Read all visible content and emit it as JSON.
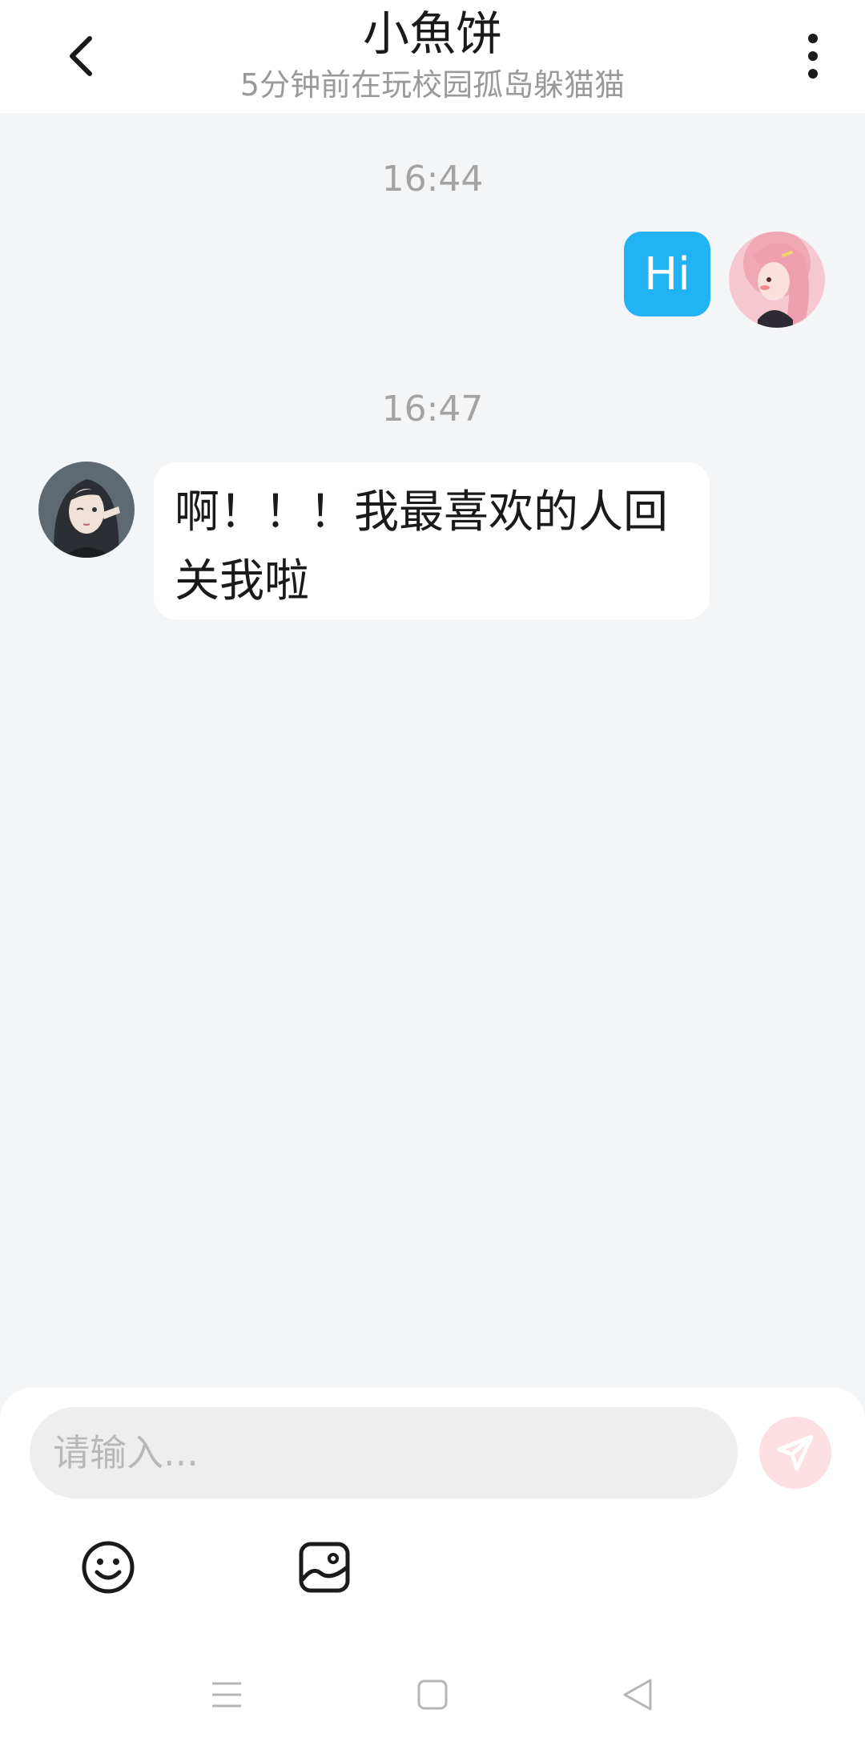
{
  "header": {
    "title": "小魚饼",
    "subtitle": "5分钟前在玩校园孤岛躲猫猫",
    "back_icon": "chevron-left-icon",
    "menu_icon": "vertical-dots-icon"
  },
  "messages": [
    {
      "time": "16:44",
      "direction": "outgoing",
      "text": "Hi"
    },
    {
      "time": "16:47",
      "direction": "incoming",
      "text": "啊！！！我最喜欢的人回关我啦"
    }
  ],
  "composer": {
    "placeholder": "请输入...",
    "send_icon": "paper-plane-icon",
    "tools": [
      "emoji-icon",
      "image-icon"
    ]
  },
  "navbar": {
    "icons": [
      "menu-icon",
      "home-square-icon",
      "back-triangle-icon"
    ]
  },
  "colors": {
    "outgoing_bubble": "#22b3f5",
    "incoming_bubble": "#ffffff",
    "chat_background": "#f4f5f7",
    "send_button": "#fde0e3",
    "send_icon": "#ffffff"
  }
}
